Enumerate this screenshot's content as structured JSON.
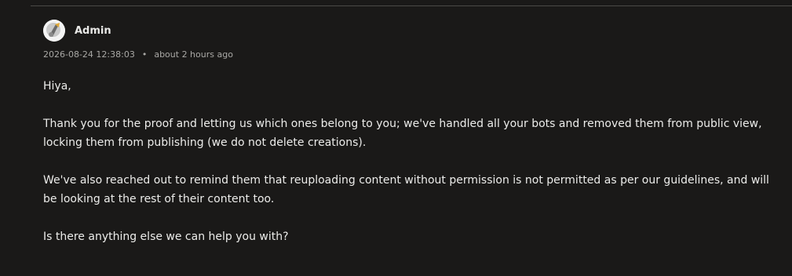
{
  "comment": {
    "author": "Admin",
    "timestamp": "2026-08-24 12:38:03",
    "separator": "•",
    "relative_time": "about 2 hours ago",
    "avatar_icon": "admin-avatar-icon",
    "paragraphs": [
      "Hiya,",
      "Thank you for the proof and letting us which ones belong to you; we've handled all your bots and removed them from public view, locking them from publishing (we do not delete creations).",
      "We've also reached out to remind them that reuploading content without permission is not permitted as per our guidelines, and will be looking at the rest of their content too.",
      "Is there anything else we can help you with?"
    ]
  },
  "colors": {
    "background": "#1a1918",
    "text": "#ececea",
    "muted_text": "#a9a8a5",
    "divider": "#4a4947"
  }
}
